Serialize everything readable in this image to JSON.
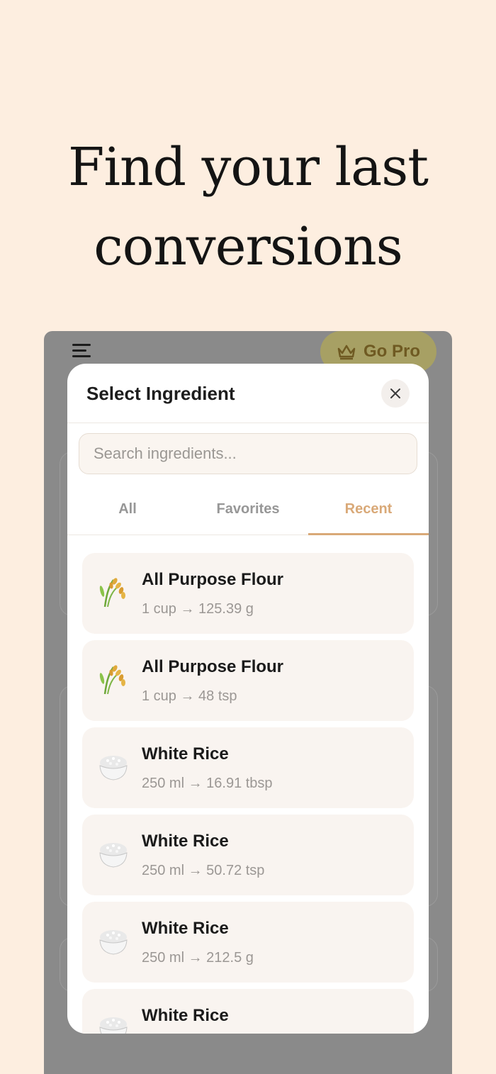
{
  "headline": {
    "line1": "Find your last",
    "line2": "conversions"
  },
  "app_bar": {
    "go_pro_label": "Go Pro",
    "menu_icon": "hamburger-menu-icon",
    "pro_icon": "crown-icon"
  },
  "modal": {
    "title": "Select Ingredient",
    "close_icon": "close-icon",
    "search_placeholder": "Search ingredients...",
    "tabs": [
      {
        "label": "All",
        "active": false
      },
      {
        "label": "Favorites",
        "active": false
      },
      {
        "label": "Recent",
        "active": true
      }
    ],
    "items": [
      {
        "name": "All Purpose Flour",
        "conversion": "1 cup → 125.39 g",
        "icon": "wheat-icon"
      },
      {
        "name": "All Purpose Flour",
        "conversion": "1 cup → 48 tsp",
        "icon": "wheat-icon"
      },
      {
        "name": "White Rice",
        "conversion": "250 ml → 16.91 tbsp",
        "icon": "rice-bowl-icon"
      },
      {
        "name": "White Rice",
        "conversion": "250 ml → 50.72 tsp",
        "icon": "rice-bowl-icon"
      },
      {
        "name": "White Rice",
        "conversion": "250 ml → 212.5 g",
        "icon": "rice-bowl-icon"
      },
      {
        "name": "White Rice",
        "conversion": "",
        "icon": "rice-bowl-icon"
      }
    ]
  },
  "colors": {
    "background": "#fdeee0",
    "accent": "#d9a978",
    "overlay": "#8a8a8a"
  }
}
